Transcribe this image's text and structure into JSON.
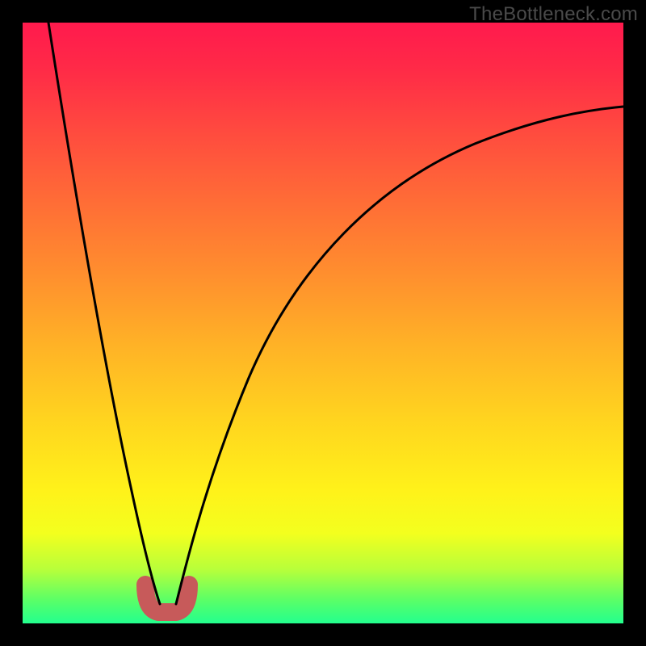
{
  "watermark": "TheBottleneck.com",
  "chart_data": {
    "type": "line",
    "title": "",
    "xlabel": "",
    "ylabel": "",
    "xlim": [
      0,
      100
    ],
    "ylim": [
      0,
      100
    ],
    "series": [
      {
        "name": "bottleneck-curve",
        "x": [
          0,
          2,
          4,
          6,
          8,
          10,
          12,
          14,
          16,
          18,
          19.5,
          20.5,
          22,
          23,
          23.5,
          24.5,
          25,
          25.5,
          26.5,
          28,
          30,
          33,
          37,
          42,
          48,
          55,
          63,
          72,
          82,
          92,
          100
        ],
        "values": [
          100,
          91,
          82,
          73,
          64,
          55,
          46,
          37,
          28,
          19,
          12,
          8,
          4,
          2,
          2,
          2,
          2,
          4,
          8,
          14,
          21,
          30,
          40,
          49,
          57,
          64,
          70,
          75,
          79,
          82,
          84
        ]
      },
      {
        "name": "trough-marker",
        "x": [
          22.5,
          23,
          23.5,
          24,
          24.5,
          25,
          25.5
        ],
        "values": [
          4,
          2,
          1.5,
          1.5,
          1.5,
          2,
          4
        ]
      }
    ],
    "colors": {
      "gradient_top": "#ff1a4d",
      "gradient_mid1": "#ff8f2e",
      "gradient_mid2": "#fff21a",
      "gradient_bottom": "#23ff8e",
      "curve": "#000000",
      "marker": "#c75a5a",
      "frame": "#000000"
    }
  }
}
